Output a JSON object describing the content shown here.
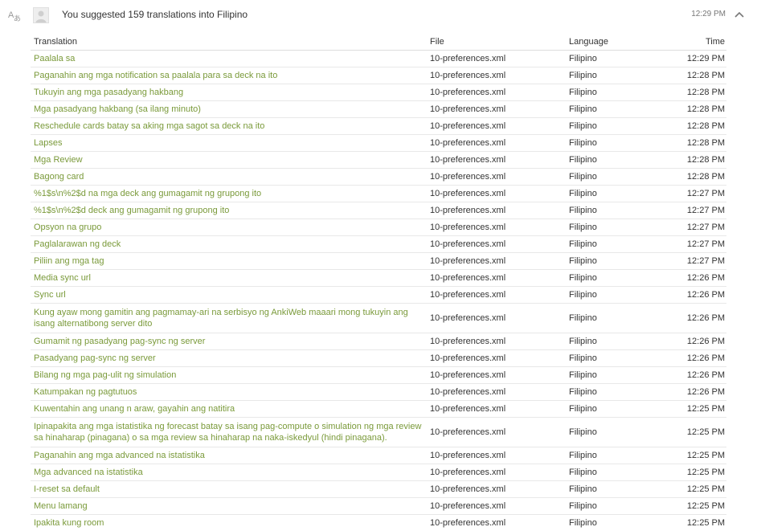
{
  "header": {
    "message": "You suggested 159 translations into Filipino",
    "time": "12:29 PM"
  },
  "columns": {
    "translation": "Translation",
    "file": "File",
    "language": "Language",
    "time": "Time"
  },
  "rows": [
    {
      "translation": "Paalala sa",
      "file": "10-preferences.xml",
      "language": "Filipino",
      "time": "12:29 PM"
    },
    {
      "translation": "Paganahin ang mga notification sa paalala para sa deck na ito",
      "file": "10-preferences.xml",
      "language": "Filipino",
      "time": "12:28 PM"
    },
    {
      "translation": "Tukuyin ang mga pasadyang hakbang",
      "file": "10-preferences.xml",
      "language": "Filipino",
      "time": "12:28 PM"
    },
    {
      "translation": "Mga pasadyang hakbang (sa ilang minuto)",
      "file": "10-preferences.xml",
      "language": "Filipino",
      "time": "12:28 PM"
    },
    {
      "translation": "Reschedule cards batay sa aking mga sagot sa deck na ito",
      "file": "10-preferences.xml",
      "language": "Filipino",
      "time": "12:28 PM"
    },
    {
      "translation": "Lapses",
      "file": "10-preferences.xml",
      "language": "Filipino",
      "time": "12:28 PM"
    },
    {
      "translation": "Mga Review",
      "file": "10-preferences.xml",
      "language": "Filipino",
      "time": "12:28 PM"
    },
    {
      "translation": "Bagong card",
      "file": "10-preferences.xml",
      "language": "Filipino",
      "time": "12:28 PM"
    },
    {
      "translation": "%1$s\\n%2$d na mga deck ang gumagamit ng grupong ito",
      "file": "10-preferences.xml",
      "language": "Filipino",
      "time": "12:27 PM"
    },
    {
      "translation": "%1$s\\n%2$d deck ang gumagamit ng grupong ito",
      "file": "10-preferences.xml",
      "language": "Filipino",
      "time": "12:27 PM"
    },
    {
      "translation": "Opsyon na grupo",
      "file": "10-preferences.xml",
      "language": "Filipino",
      "time": "12:27 PM"
    },
    {
      "translation": "Paglalarawan ng deck",
      "file": "10-preferences.xml",
      "language": "Filipino",
      "time": "12:27 PM"
    },
    {
      "translation": "Piliin ang mga tag",
      "file": "10-preferences.xml",
      "language": "Filipino",
      "time": "12:27 PM"
    },
    {
      "translation": "Media sync url",
      "file": "10-preferences.xml",
      "language": "Filipino",
      "time": "12:26 PM"
    },
    {
      "translation": "Sync url",
      "file": "10-preferences.xml",
      "language": "Filipino",
      "time": "12:26 PM"
    },
    {
      "translation": "Kung ayaw mong gamitin ang pagmamay-ari na serbisyo ng AnkiWeb maaari mong tukuyin ang isang alternatibong server dito",
      "file": "10-preferences.xml",
      "language": "Filipino",
      "time": "12:26 PM",
      "multi": true
    },
    {
      "translation": "Gumamit ng pasadyang pag-sync ng server",
      "file": "10-preferences.xml",
      "language": "Filipino",
      "time": "12:26 PM"
    },
    {
      "translation": "Pasadyang pag-sync ng server",
      "file": "10-preferences.xml",
      "language": "Filipino",
      "time": "12:26 PM"
    },
    {
      "translation": "Bilang ng mga pag-ulit ng simulation",
      "file": "10-preferences.xml",
      "language": "Filipino",
      "time": "12:26 PM"
    },
    {
      "translation": "Katumpakan ng pagtutuos",
      "file": "10-preferences.xml",
      "language": "Filipino",
      "time": "12:26 PM"
    },
    {
      "translation": "Kuwentahin ang unang n araw, gayahin ang natitira",
      "file": "10-preferences.xml",
      "language": "Filipino",
      "time": "12:25 PM"
    },
    {
      "translation": "Ipinapakita ang mga istatistika ng forecast batay sa isang pag-compute o simulation ng mga review sa hinaharap (pinagana) o sa mga review sa hinaharap na naka-iskedyul (hindi pinagana).",
      "file": "10-preferences.xml",
      "language": "Filipino",
      "time": "12:25 PM",
      "multi": true
    },
    {
      "translation": "Paganahin ang mga advanced na istatistika",
      "file": "10-preferences.xml",
      "language": "Filipino",
      "time": "12:25 PM"
    },
    {
      "translation": "Mga advanced na istatistika",
      "file": "10-preferences.xml",
      "language": "Filipino",
      "time": "12:25 PM"
    },
    {
      "translation": "I-reset sa default",
      "file": "10-preferences.xml",
      "language": "Filipino",
      "time": "12:25 PM"
    },
    {
      "translation": "Menu lamang",
      "file": "10-preferences.xml",
      "language": "Filipino",
      "time": "12:25 PM"
    },
    {
      "translation": "Ipakita kung room",
      "file": "10-preferences.xml",
      "language": "Filipino",
      "time": "12:25 PM"
    }
  ],
  "colors": {
    "link": "#7a9a3a",
    "text": "#333333",
    "muted": "#777777",
    "divider": "#e8e8e8"
  },
  "icons": {
    "left": "translate-icon",
    "avatar": "user-avatar-icon",
    "collapse": "chevron-up-icon"
  }
}
